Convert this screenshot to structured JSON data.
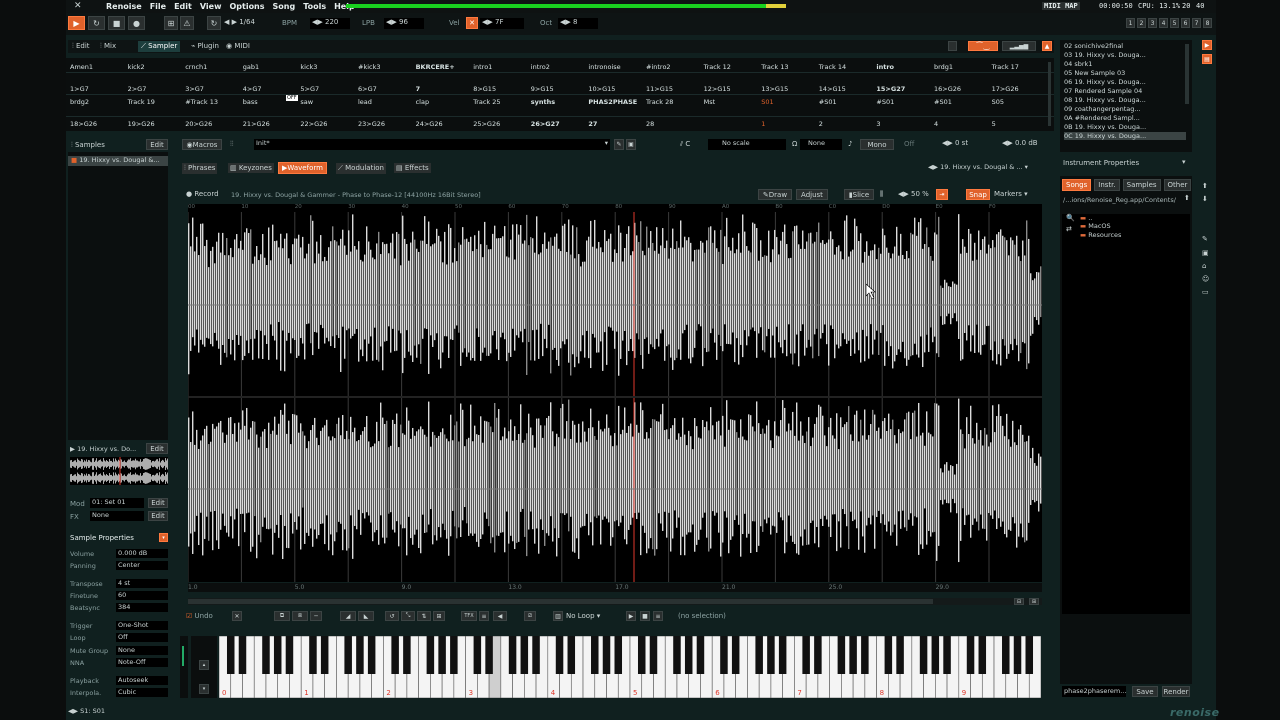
{
  "menu": [
    "Renoise",
    "File",
    "Edit",
    "View",
    "Options",
    "Song",
    "Tools",
    "Help"
  ],
  "status": {
    "midi_map": "MIDI MAP",
    "time": "00:00:50",
    "cpu": "CPU: 13.1%",
    "rows": "20",
    "lines": "40"
  },
  "transport": {
    "step": "1/64",
    "bpm_label": "BPM",
    "bpm": "220",
    "lpb_label": "LPB",
    "lpb": "96",
    "vel_label": "Vel",
    "vel": "7F",
    "oct_label": "Oct",
    "oct": "8"
  },
  "track_numbers": [
    "1",
    "2",
    "3",
    "4",
    "5",
    "6",
    "7",
    "8"
  ],
  "upper_tabs": [
    "Edit",
    "Mix",
    "Sampler",
    "Plugin",
    "MIDI"
  ],
  "matrix": {
    "row1": [
      "Amen1",
      "kick2",
      "crnch1",
      "gab1",
      "kick3",
      "#kick3",
      "BKRCERE+",
      "intro1",
      "intro2",
      "intronoise",
      "#intro2",
      "Track 12",
      "Track 13",
      "Track 14",
      "intro",
      "brdg1",
      "Track 17"
    ],
    "row2": [
      "1>G7",
      "2>G7",
      "3>G7",
      "4>G7",
      "5>G7",
      "6>G7",
      "7",
      "8>G15",
      "9>G15",
      "10>G15",
      "11>G15",
      "12>G15",
      "13>G15",
      "14>G15",
      "15>G27",
      "16>G26",
      "17>G26"
    ],
    "row3": [
      "brdg2",
      "Track 19",
      "#Track 13",
      "bass",
      "saw",
      "lead",
      "clap",
      "Track 25",
      "synths",
      "PHAS2PHASE",
      "Track 28",
      "Mst",
      "S01",
      "#S01",
      "#S01",
      "#S01",
      "S05"
    ],
    "row4": [
      "18>G26",
      "19>G26",
      "20>G26",
      "21>G26",
      "22>G26",
      "23>G26",
      "24>G26",
      "25>G26",
      "26>G27",
      "27",
      "28",
      "",
      "1",
      "2",
      "3",
      "4",
      "5"
    ],
    "off": "OFF"
  },
  "instruments": [
    {
      "num": "02",
      "name": "sonichive2final"
    },
    {
      "num": "03",
      "name": "19. Hixxy vs. Douga..."
    },
    {
      "num": "04",
      "name": "sbrk1"
    },
    {
      "num": "05",
      "name": "New Sample 03"
    },
    {
      "num": "06",
      "name": "19. Hixxy vs. Douga..."
    },
    {
      "num": "07",
      "name": "Rendered Sample 04"
    },
    {
      "num": "08",
      "name": "19. Hixxy vs. Douga..."
    },
    {
      "num": "09",
      "name": "coathangerpentag..."
    },
    {
      "num": "0A",
      "name": "#Rendered Sampl..."
    },
    {
      "num": "0B",
      "name": "19. Hixxy vs. Douga..."
    },
    {
      "num": "0C",
      "name": "19. Hixxy vs. Douga..."
    }
  ],
  "instrument_properties": "Instrument Properties",
  "browser": {
    "tabs": [
      "Songs",
      "Instr.",
      "Samples",
      "Other"
    ],
    "path": "/...ions/Renoise_Reg.app/Contents/",
    "items": [
      "..",
      "MacOS",
      "Resources"
    ],
    "filename": "phase2phaserem...",
    "save": "Save",
    "render": "Render"
  },
  "samples_header": {
    "label": "Samples",
    "edit": "Edit"
  },
  "sample_selected": "19. Hixxy vs. Dougal &...",
  "sample_mini": {
    "name": "19. Hixxy vs. Do...",
    "edit": "Edit"
  },
  "mod": {
    "label": "Mod",
    "value": "01: Set 01",
    "edit": "Edit"
  },
  "fx": {
    "label": "FX",
    "value": "None",
    "edit": "Edit"
  },
  "sample_props": {
    "title": "Sample Properties",
    "volume": [
      "Volume",
      "0.000 dB"
    ],
    "panning": [
      "Panning",
      "Center"
    ],
    "transpose": [
      "Transpose",
      "4 st"
    ],
    "finetune": [
      "Finetune",
      "60"
    ],
    "beatsync": [
      "Beatsync",
      "384"
    ],
    "trigger": [
      "Trigger",
      "One-Shot"
    ],
    "loop": [
      "Loop",
      "Off"
    ],
    "mutegroup": [
      "Mute Group",
      "None"
    ],
    "nna": [
      "NNA",
      "Note-Off"
    ],
    "playback": [
      "Playback",
      "Autoseek"
    ],
    "interpolation": [
      "Interpola.",
      "Cubic"
    ]
  },
  "bottom_left": "S1: S01",
  "macros": {
    "label": "Macros",
    "preset": "Init*",
    "scale": "No scale",
    "key": "C",
    "chord": "None",
    "mono": "Mono",
    "off": "Off",
    "st": "0 st",
    "db": "0.0 dB"
  },
  "editor_tabs": [
    "Phrases",
    "Keyzones",
    "Waveform",
    "Modulation",
    "Effects"
  ],
  "editor_sample_name": "19. Hixxy vs. Dougal & ...",
  "wave_toolbar": {
    "record": "Record",
    "title": "19. Hixxy vs. Dougal & Gammer - Phase to Phase-12 [44100Hz 16Bit Stereo]",
    "draw": "Draw",
    "adjust": "Adjust",
    "slice": "Slice",
    "zoom": "50 %",
    "snap": "Snap",
    "markers": "Markers"
  },
  "top_ruler": [
    "00",
    "10",
    "20",
    "30",
    "40",
    "50",
    "60",
    "70",
    "80",
    "90",
    "A0",
    "B0",
    "C0",
    "D0",
    "E0",
    "F0"
  ],
  "bottom_ruler": [
    "1.0",
    "5.0",
    "9.0",
    "13.0",
    "17.0",
    "21.0",
    "25.0",
    "29.0"
  ],
  "bottom_toolbar": {
    "undo": "Undo",
    "loop": "No Loop",
    "selection": "(no selection)"
  },
  "piano_octaves": [
    "0",
    "1",
    "2",
    "3",
    "4",
    "5",
    "6",
    "7",
    "8",
    "9"
  ],
  "logo": "renoise"
}
